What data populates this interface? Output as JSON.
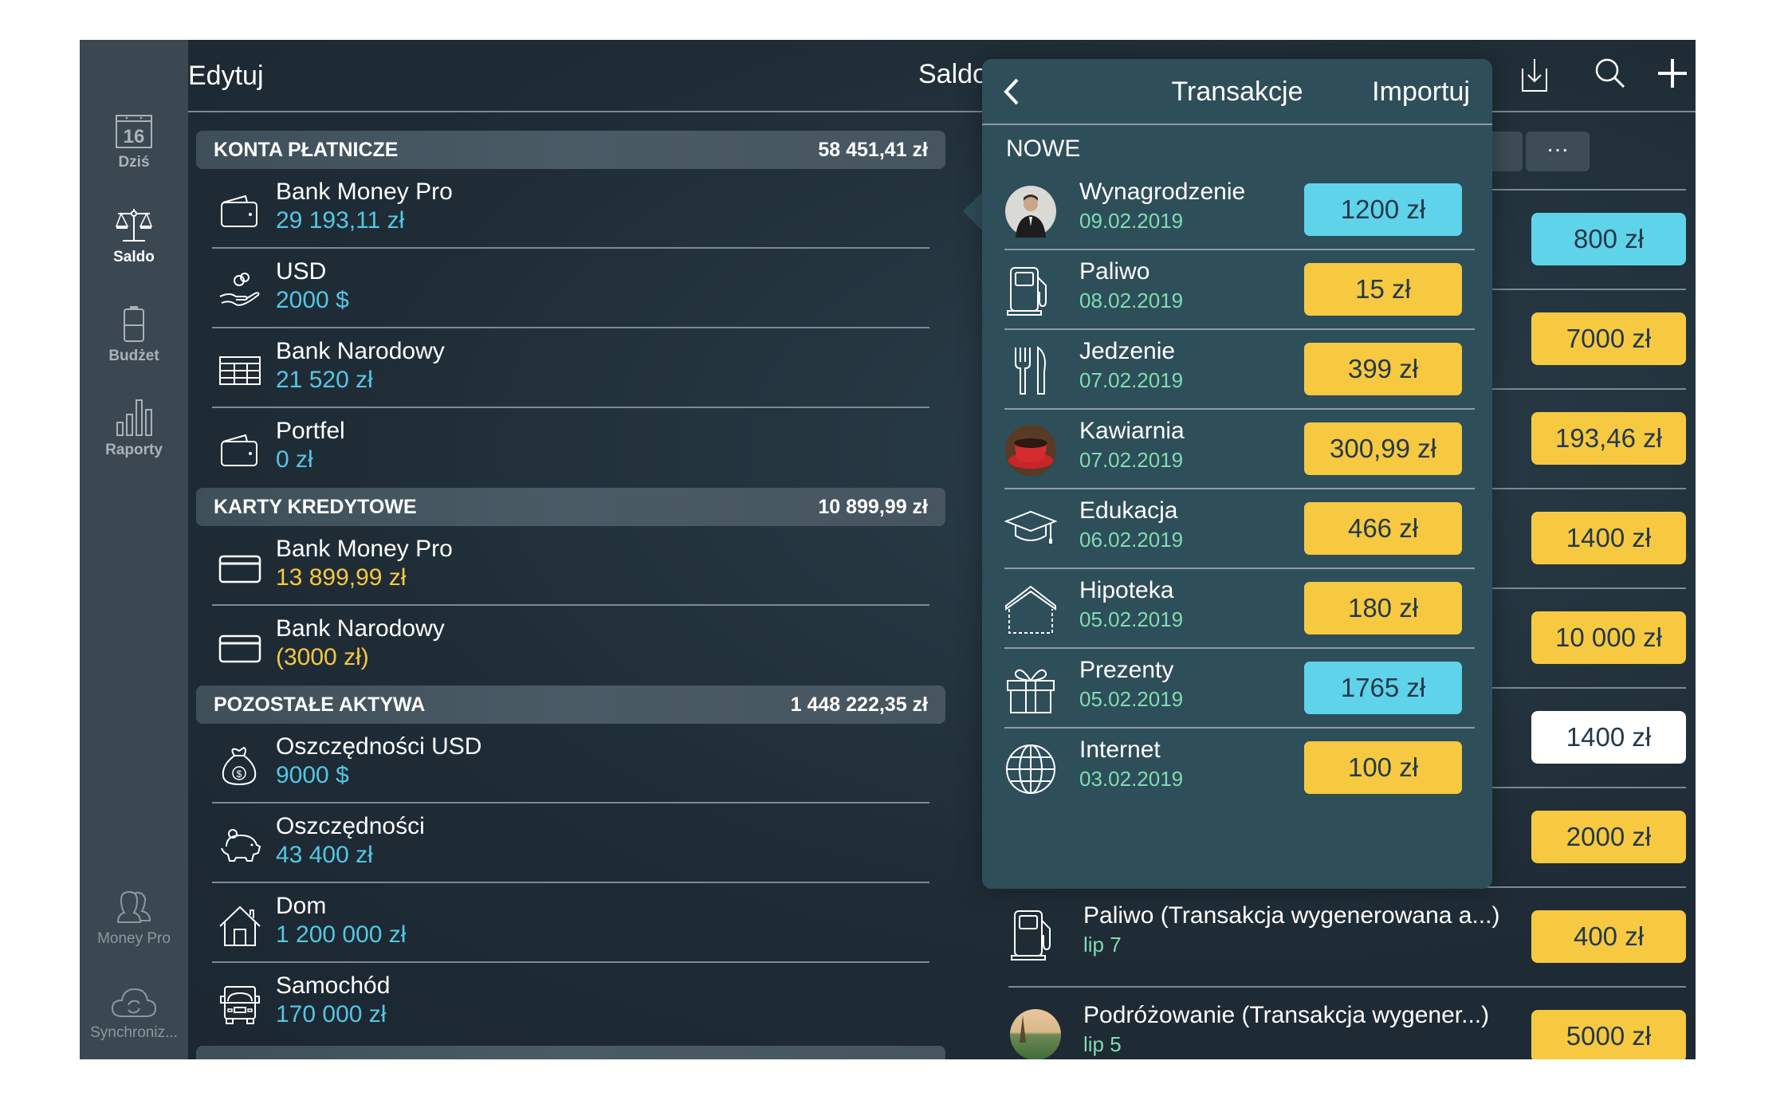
{
  "sidebar": {
    "items": [
      {
        "label": "Dziś",
        "icon": "calendar-icon",
        "day": "16"
      },
      {
        "label": "Saldo",
        "icon": "scales-icon"
      },
      {
        "label": "Budżet",
        "icon": "battery-icon"
      },
      {
        "label": "Raporty",
        "icon": "bar-chart-icon"
      }
    ],
    "bottom": [
      {
        "label": "Money Pro",
        "icon": "users-icon"
      },
      {
        "label": "Synchroniz...",
        "icon": "cloud-sync-icon"
      }
    ]
  },
  "header": {
    "edit_label": "Edytuj",
    "title": "Saldo",
    "icons": [
      "download-icon",
      "search-icon",
      "plus-icon"
    ]
  },
  "segments": {
    "more_label": "···"
  },
  "accounts": {
    "sections": [
      {
        "title": "KONTA PŁATNICZE",
        "total": "58 451,41 zł",
        "items": [
          {
            "name": "Bank Money Pro",
            "value": "29 193,11 zł",
            "icon": "wallet-icon",
            "color": "blue"
          },
          {
            "name": "USD",
            "value": "2000 $",
            "icon": "coins-hand-icon",
            "color": "blue"
          },
          {
            "name": "Bank Narodowy",
            "value": "21 520 zł",
            "icon": "bank-table-icon",
            "color": "blue"
          },
          {
            "name": "Portfel",
            "value": "0 zł",
            "icon": "wallet-icon",
            "color": "blue"
          }
        ]
      },
      {
        "title": "KARTY KREDYTOWE",
        "total": "10 899,99 zł",
        "items": [
          {
            "name": "Bank Money Pro",
            "value": "13 899,99 zł",
            "icon": "credit-card-icon",
            "color": "yellow"
          },
          {
            "name": "Bank Narodowy",
            "value": "(3000 zł)",
            "icon": "credit-card-icon",
            "color": "yellow"
          }
        ]
      },
      {
        "title": "POZOSTAŁE AKTYWA",
        "total": "1 448 222,35 zł",
        "items": [
          {
            "name": "Oszczędności USD",
            "value": "9000 $",
            "icon": "money-bag-icon",
            "color": "blue"
          },
          {
            "name": "Oszczędności",
            "value": "43 400 zł",
            "icon": "piggy-bank-icon",
            "color": "blue"
          },
          {
            "name": "Dom",
            "value": "1 200 000 zł",
            "icon": "house-icon",
            "color": "blue"
          },
          {
            "name": "Samochód",
            "value": "170 000 zł",
            "icon": "truck-icon",
            "color": "blue"
          }
        ]
      }
    ]
  },
  "right_list": {
    "items": [
      {
        "text_tail": ")",
        "amount": "800 zł",
        "color": "#5fd3ea"
      },
      {
        "text_tail": "..)",
        "amount": "7000 zł",
        "color": "#f6c940"
      },
      {
        "text_tail": "",
        "amount": "193,46 zł",
        "color": "#f6c940"
      },
      {
        "text_tail": "..)",
        "amount": "1400 zł",
        "color": "#f6c940"
      },
      {
        "text_tail": ".)",
        "amount": "10 000 zł",
        "color": "#f6c940"
      },
      {
        "text_tail": ")",
        "amount": "1400 zł",
        "color": "#ffffff"
      },
      {
        "text_tail": ".)",
        "amount": "2000 zł",
        "color": "#f6c940"
      },
      {
        "text": "Paliwo (Transakcja wygenerowana a...)",
        "date": "lip 7",
        "amount": "400 zł",
        "color": "#f6c940",
        "icon": "fuel-pump-icon"
      },
      {
        "text": "Podróżowanie (Transakcja wygener...)",
        "date": "lip 5",
        "amount": "5000 zł",
        "color": "#f6c940",
        "icon": "travel-photo-icon"
      }
    ]
  },
  "popover": {
    "back_label": "<",
    "title": "Transakcje",
    "import_label": "Importuj",
    "section": "NOWE",
    "items": [
      {
        "name": "Wynagrodzenie",
        "date": "09.02.2019",
        "amount": "1200 zł",
        "type": "income",
        "icon": "person-photo-icon"
      },
      {
        "name": "Paliwo",
        "date": "08.02.2019",
        "amount": "15 zł",
        "type": "expense",
        "icon": "fuel-pump-icon"
      },
      {
        "name": "Jedzenie",
        "date": "07.02.2019",
        "amount": "399 zł",
        "type": "expense",
        "icon": "fork-knife-icon"
      },
      {
        "name": "Kawiarnia",
        "date": "07.02.2019",
        "amount": "300,99 zł",
        "type": "expense",
        "icon": "coffee-cup-icon"
      },
      {
        "name": "Edukacja",
        "date": "06.02.2019",
        "amount": "466 zł",
        "type": "expense",
        "icon": "graduation-cap-icon"
      },
      {
        "name": "Hipoteka",
        "date": "05.02.2019",
        "amount": "180 zł",
        "type": "expense",
        "icon": "house-outline-icon"
      },
      {
        "name": "Prezenty",
        "date": "05.02.2019",
        "amount": "1765 zł",
        "type": "income",
        "icon": "gift-icon"
      },
      {
        "name": "Internet",
        "date": "03.02.2019",
        "amount": "100 zł",
        "type": "expense",
        "icon": "globe-icon"
      }
    ]
  },
  "colors": {
    "income": "#5fd3ea",
    "expense": "#f6c940",
    "neutral": "#ffffff",
    "positive_text": "#54c6e4",
    "negative_text": "#f5c842",
    "date_text": "#7fdcb5",
    "popover_bg": "#2e4e5a",
    "sidebar_bg": "#3b4852"
  }
}
